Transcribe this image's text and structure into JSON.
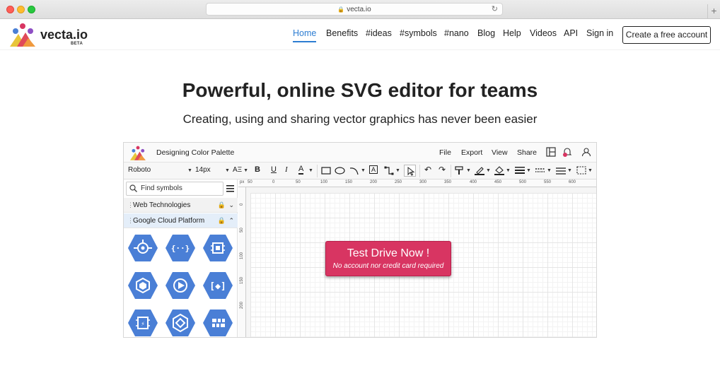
{
  "browser": {
    "url": "vecta.io"
  },
  "site": {
    "brand": "vecta.io",
    "beta": "BETA",
    "nav": [
      {
        "label": "Home",
        "active": true
      },
      {
        "label": "Benefits"
      },
      {
        "label": "#ideas"
      },
      {
        "label": "#symbols"
      },
      {
        "label": "#nano"
      },
      {
        "label": "Blog"
      },
      {
        "label": "Help"
      },
      {
        "label": "Videos"
      },
      {
        "label": "API"
      },
      {
        "label": "Sign in"
      }
    ],
    "cta": "Create a free account",
    "accent": "#2d7dd2"
  },
  "hero": {
    "title": "Powerful, online SVG editor for teams",
    "subtitle": "Creating, using and sharing vector graphics has never been easier"
  },
  "editor": {
    "doc_title": "Designing Color Palette",
    "menu": [
      "File",
      "Export",
      "View",
      "Share"
    ],
    "font": "Roboto",
    "font_size": "14px",
    "search_placeholder": "Find symbols",
    "panels": [
      {
        "label": "Web Technologies",
        "expanded": false
      },
      {
        "label": "Google Cloud Platform",
        "expanded": true
      }
    ],
    "ruler_x": [
      "50",
      "0",
      "50",
      "100",
      "150",
      "200",
      "250",
      "300",
      "350",
      "400",
      "450",
      "500",
      "550",
      "600"
    ],
    "ruler_x_unit": "px",
    "ruler_y": [
      "0",
      "50",
      "100",
      "150",
      "200"
    ],
    "hex_icons": [
      "gcp-endpoints",
      "gcp-api",
      "gcp-compute-engine",
      "gcp-container-engine",
      "gcp-storage",
      "gcp-container-registry",
      "gcp-processor",
      "gcp-dataflow",
      "gcp-dataproc"
    ],
    "hex_color": "#4a7fd6"
  },
  "promo": {
    "title": "Test Drive Now !",
    "subtitle": "No account nor credit card required",
    "color": "#d83562"
  }
}
